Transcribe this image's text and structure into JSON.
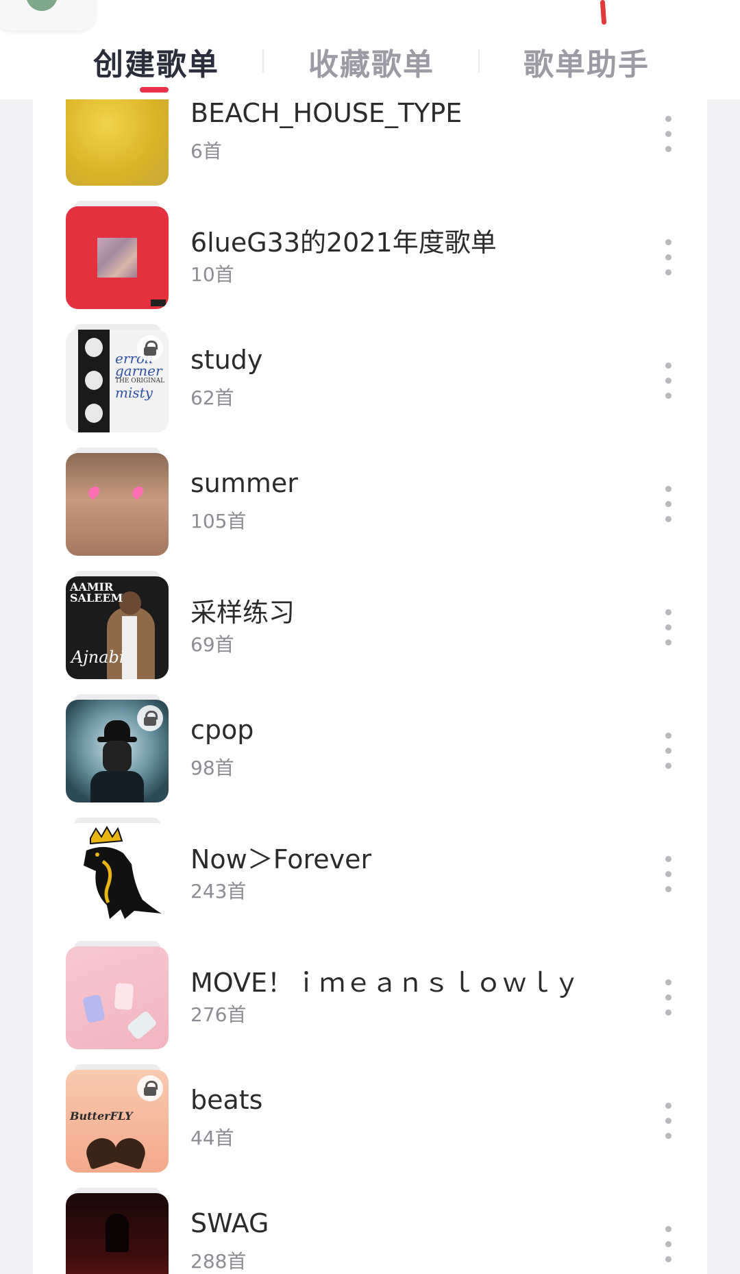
{
  "tabs": [
    {
      "label": "创建歌单",
      "active": true
    },
    {
      "label": "收藏歌单",
      "active": false
    },
    {
      "label": "歌单助手",
      "active": false
    }
  ],
  "colors": {
    "accent": "#e8324a",
    "active_tab": "#2b2d3a",
    "inactive_tab": "#9b9ba3",
    "count_text": "#8c8c92"
  },
  "playlists": [
    {
      "title": "BEACH_HOUSE_TYPE",
      "count": "6首",
      "locked": false,
      "cover": "yellow-abstract-cover"
    },
    {
      "title": "6lueG33的2021年度歌单",
      "count": "10首",
      "locked": false,
      "cover": "red-pixel-cover"
    },
    {
      "title": "study",
      "count": "62首",
      "locked": true,
      "cover": "erroll-garner-misty-cover",
      "cover_text": [
        "erroll",
        "garner",
        "THE ORIGINAL",
        "misty"
      ]
    },
    {
      "title": "summer",
      "count": "105首",
      "locked": false,
      "cover": "face-heart-eyes-cover"
    },
    {
      "title": "采样练习",
      "count": "69首",
      "locked": false,
      "cover": "aamir-saleem-ajnabi-cover",
      "cover_text": [
        "AAMIR",
        "SALEEM",
        "Ajnabi"
      ]
    },
    {
      "title": "cpop",
      "count": "98首",
      "locked": true,
      "cover": "gas-mask-figure-cover"
    },
    {
      "title": "Now＞Forever",
      "count": "243首",
      "locked": false,
      "cover": "crowned-dinosaur-cover"
    },
    {
      "title": "MOVE！ｉｍｅａｎｓｌｏｗｌｙ",
      "count": "276首",
      "locked": false,
      "cover": "pastel-cans-cover"
    },
    {
      "title": "beats",
      "count": "44首",
      "locked": true,
      "cover": "butterfly-cover",
      "cover_text": [
        "ButterFLY"
      ]
    },
    {
      "title": "SWAG",
      "count": "288首",
      "locked": false,
      "cover": "dark-red-figure-cover"
    }
  ]
}
